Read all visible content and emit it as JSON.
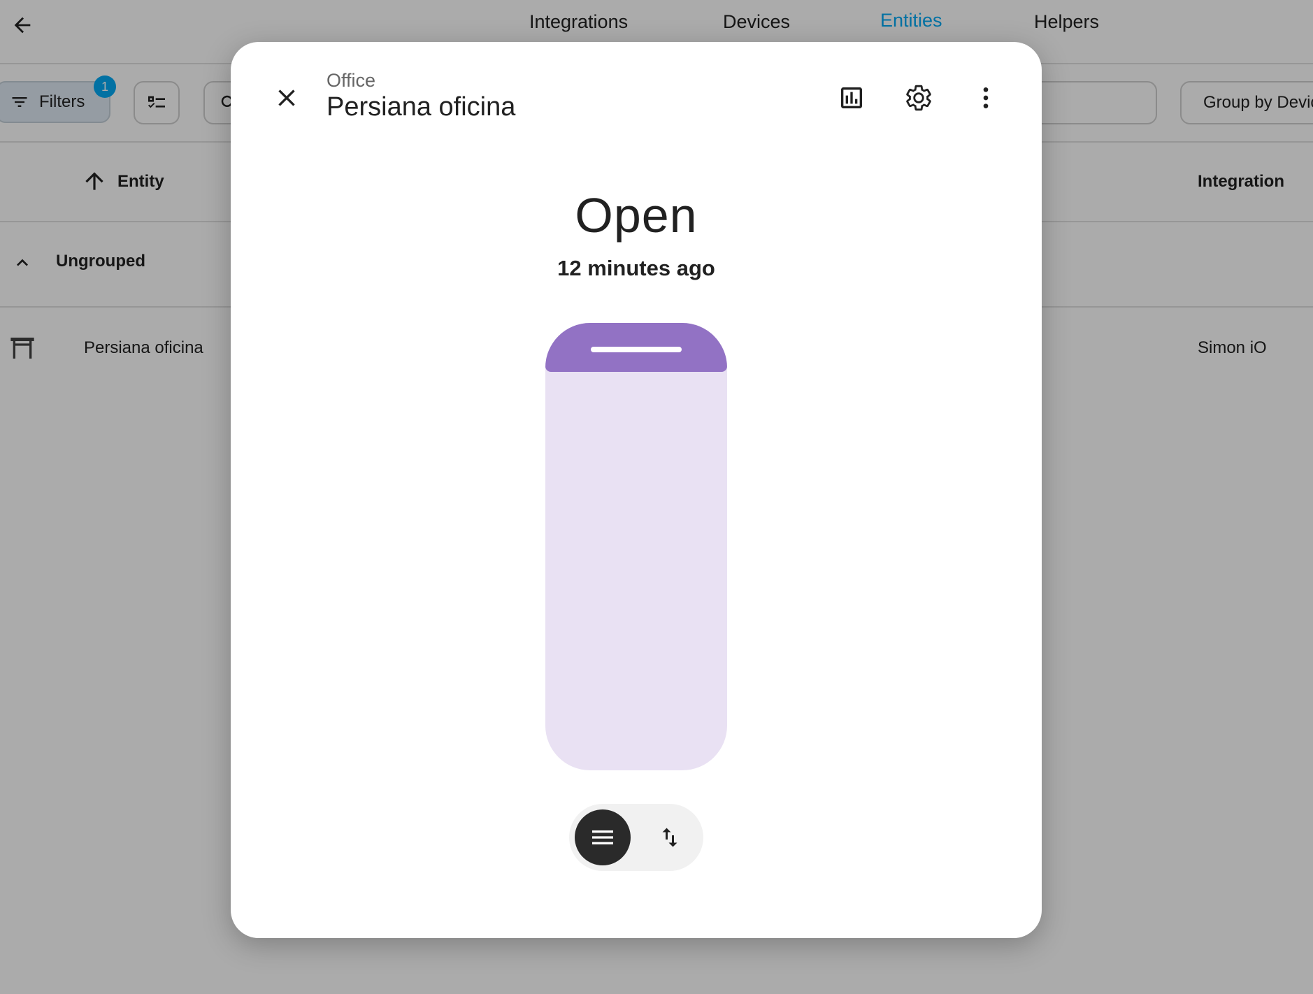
{
  "topbar": {
    "tabs": [
      {
        "label": "Integrations",
        "active": false
      },
      {
        "label": "Devices",
        "active": false
      },
      {
        "label": "Entities",
        "active": true
      },
      {
        "label": "Helpers",
        "active": false
      }
    ]
  },
  "toolbar": {
    "filters_label": "Filters",
    "filters_count": "1",
    "group_by_label": "Group by Device"
  },
  "table": {
    "columns": {
      "entity": "Entity",
      "integration": "Integration"
    },
    "group_label": "Ungrouped",
    "rows": [
      {
        "entity": "Persiana oficina",
        "integration": "Simon iO"
      }
    ]
  },
  "dialog": {
    "area": "Office",
    "title": "Persiana oficina",
    "state": "Open",
    "last_changed": "12 minutes ago",
    "position_fraction": 0.11
  },
  "colors": {
    "accent": "#03a9f4",
    "cover_fill": "#9272c4",
    "cover_track": "#e9e1f3"
  },
  "icons": {
    "back": "arrow-left-icon",
    "filter": "filter-icon",
    "select": "checklist-icon",
    "search": "search-icon",
    "sort": "arrow-up-icon",
    "group_toggle": "chevron-up-icon",
    "entity": "window-shutter-icon",
    "close": "close-icon",
    "history": "chart-box-icon",
    "settings": "gear-icon",
    "more": "dots-vertical-icon",
    "mode_position": "menu-icon",
    "mode_buttons": "swap-vertical-icon"
  }
}
